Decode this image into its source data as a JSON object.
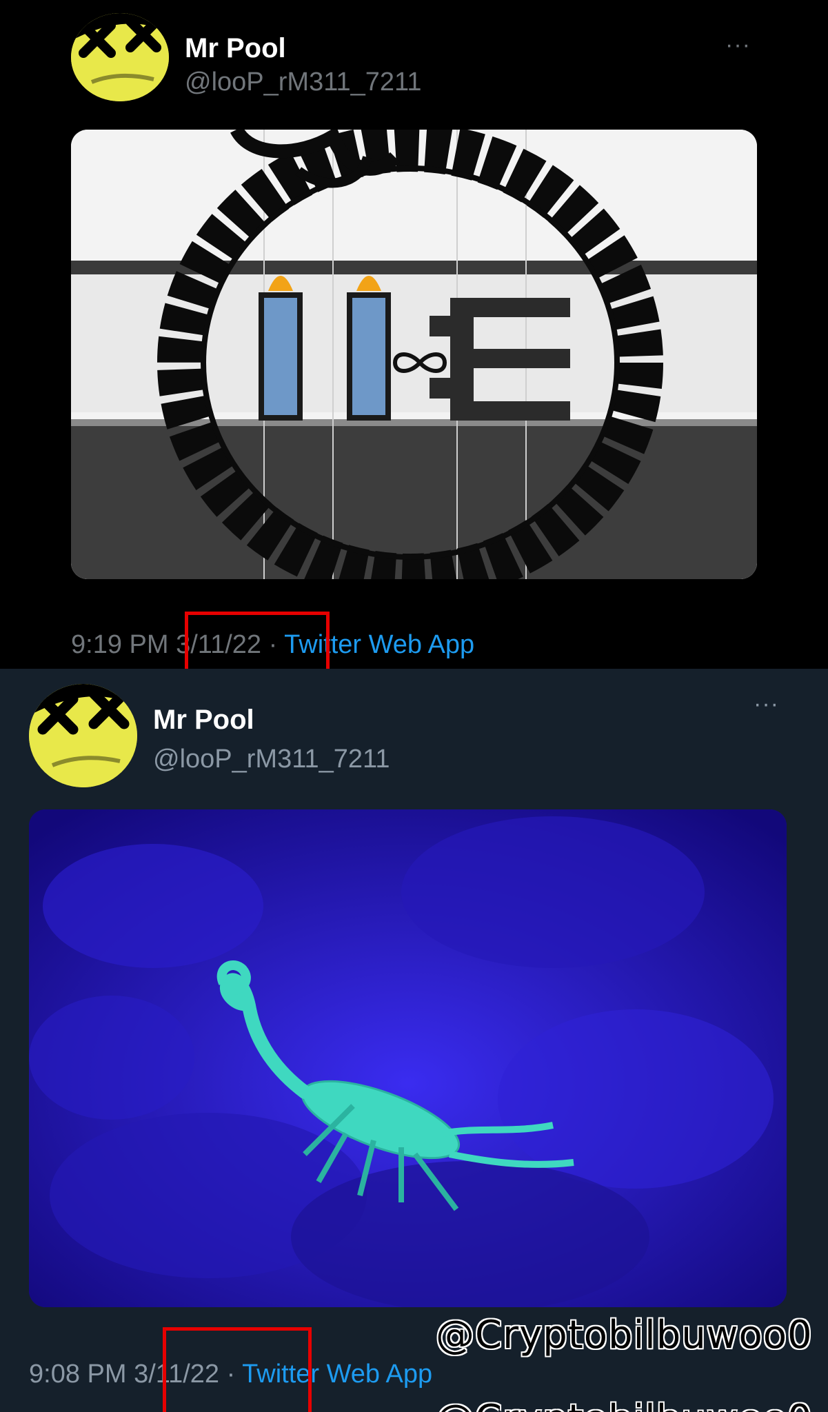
{
  "tweets": [
    {
      "author": {
        "name": "Mr Pool",
        "handle": "@looP_rM311_7211"
      },
      "more_label": "···",
      "media": {
        "description_icon": "ouroboros-serpent-image"
      },
      "time": "9:19 PM",
      "separator": " · ",
      "date": "3/11/22",
      "source": "Twitter Web App"
    },
    {
      "author": {
        "name": "Mr Pool",
        "handle": "@looP_rM311_7211"
      },
      "more_label": "···",
      "media": {
        "description_icon": "glowing-scorpion-image"
      },
      "time": "9:08 PM",
      "separator": " · ",
      "date": "3/11/22",
      "source": "Twitter Web App"
    }
  ],
  "watermark": "@Cryptobilbuwoo0",
  "colors": {
    "tweet1_background": "#000000",
    "tweet2_background": "#15202b",
    "link": "#1d9bf0",
    "highlight": "#e60000",
    "avatar": "#e8e84a"
  }
}
